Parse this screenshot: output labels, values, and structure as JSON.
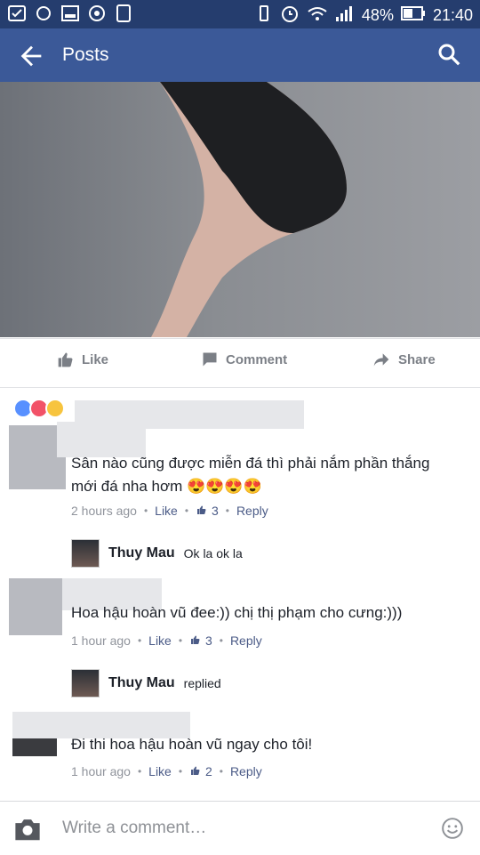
{
  "status_bar": {
    "battery": "48%",
    "time": "21:40"
  },
  "app_bar": {
    "title": "Posts",
    "back_icon": "back-arrow-icon",
    "search_icon": "search-icon"
  },
  "actions": {
    "like": "Like",
    "comment": "Comment",
    "share": "Share"
  },
  "comments": [
    {
      "text_line1": "Sân nào cũng được miễn đá thì phải nắm phần thắng",
      "text_line2": "mới đá nha hơm 😍😍😍😍",
      "time": "2 hours ago",
      "like": "Like",
      "likes": "3",
      "reply": "Reply"
    },
    {
      "text_line1": "Hoa hậu hoàn vũ đee:)) chị thị phạm cho cưng:)))",
      "time": "1 hour ago",
      "like": "Like",
      "likes": "3",
      "reply": "Reply"
    },
    {
      "text_line1": "Đi thi hoa hậu hoàn vũ ngay cho tôi!",
      "time": "1 hour ago",
      "like": "Like",
      "likes": "2",
      "reply": "Reply"
    }
  ],
  "replies": [
    {
      "name": "Thuy Mau",
      "text": "Ok la ok la"
    },
    {
      "name": "Thuy Mau",
      "text": "replied"
    }
  ],
  "composer": {
    "placeholder": "Write a comment…"
  }
}
